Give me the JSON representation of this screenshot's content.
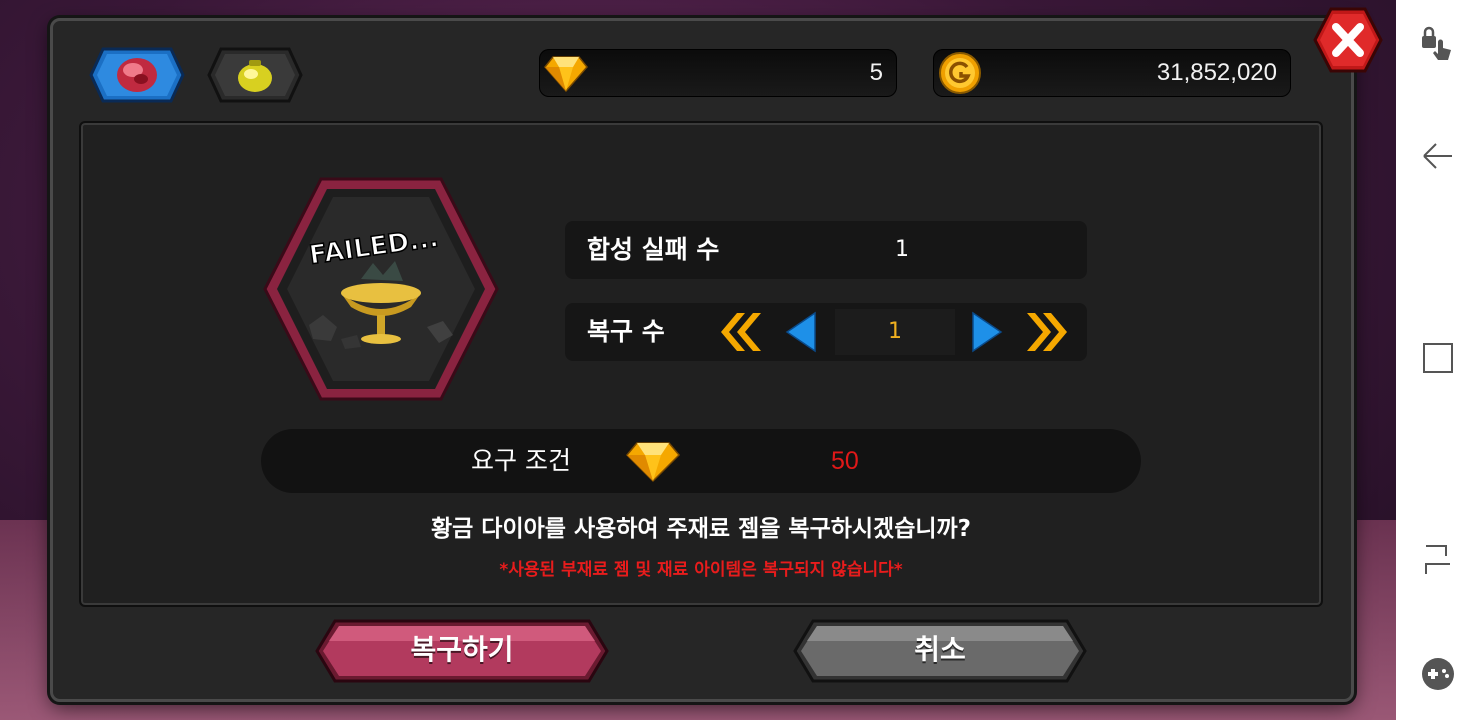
{
  "currency": {
    "diamond": {
      "icon": "diamond-icon",
      "value": "5"
    },
    "gold": {
      "icon": "gold-coin-icon",
      "value": "31,852,020"
    }
  },
  "tabs": [
    {
      "icon": "ruby-gem-icon",
      "active": true
    },
    {
      "icon": "gold-pot-icon",
      "active": false
    }
  ],
  "result": {
    "status_text": "FAILED...",
    "fail_label": "합성 실패 수",
    "fail_count": "1",
    "restore_label": "복구 수",
    "restore_count": "1"
  },
  "requirement": {
    "label": "요구 조건",
    "icon": "diamond-icon",
    "value": "50"
  },
  "message": {
    "question": "황금 다이아를 사용하여 주재료 젬을 복구하시겠습니까?",
    "warning": "*사용된 부재료 젬 및 재료 아이템은 복구되지 않습니다*"
  },
  "buttons": {
    "restore": "복구하기",
    "cancel": "취소"
  },
  "colors": {
    "restore_button": "#b23a5e",
    "cancel_button": "#6a6a6a",
    "requirement_value": "#e01818",
    "warning_text": "#e81c1c",
    "stepper_value": "#f0b020"
  },
  "navbar": [
    "screen-lock-touch-icon",
    "back-icon",
    "recent-apps-icon",
    "split-screen-icon",
    "game-tools-icon"
  ]
}
